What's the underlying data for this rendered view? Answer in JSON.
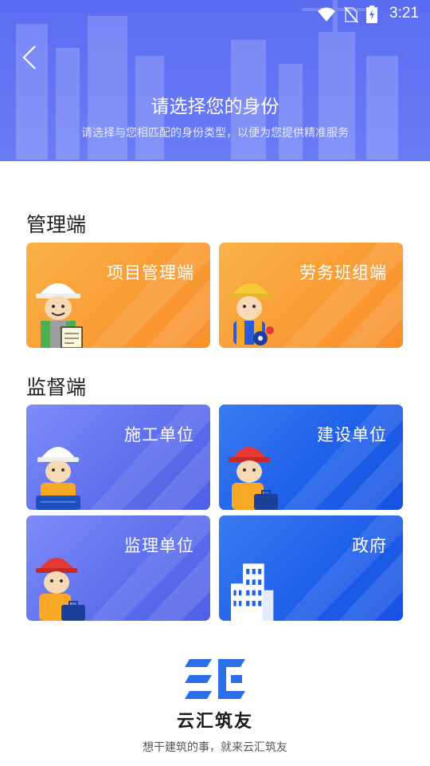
{
  "status_bar": {
    "time": "3:21"
  },
  "header": {
    "title": "请选择您的身份",
    "subtitle": "请选择与您相匹配的身份类型，以便为您提供精准服务"
  },
  "sections": {
    "management": {
      "title": "管理端",
      "cards": [
        {
          "label": "项目管理端",
          "icon": "worker-clipboard-icon"
        },
        {
          "label": "劳务班组端",
          "icon": "worker-gear-icon"
        }
      ]
    },
    "supervision": {
      "title": "监督端",
      "cards": [
        {
          "label": "施工单位",
          "icon": "worker-blueprint-icon"
        },
        {
          "label": "建设单位",
          "icon": "worker-briefcase-icon"
        },
        {
          "label": "监理单位",
          "icon": "worker-briefcase-icon"
        },
        {
          "label": "政府",
          "icon": "building-icon"
        }
      ]
    }
  },
  "footer": {
    "brand_name": "云汇筑友",
    "slogan": "想干建筑的事，就来云汇筑友"
  },
  "colors": {
    "header": "#5a6cf2",
    "orange_card": "#f99a33",
    "light_blue_card": "#5f70ee",
    "deep_blue_card": "#1f60ea",
    "logo": "#2a6fe8"
  }
}
